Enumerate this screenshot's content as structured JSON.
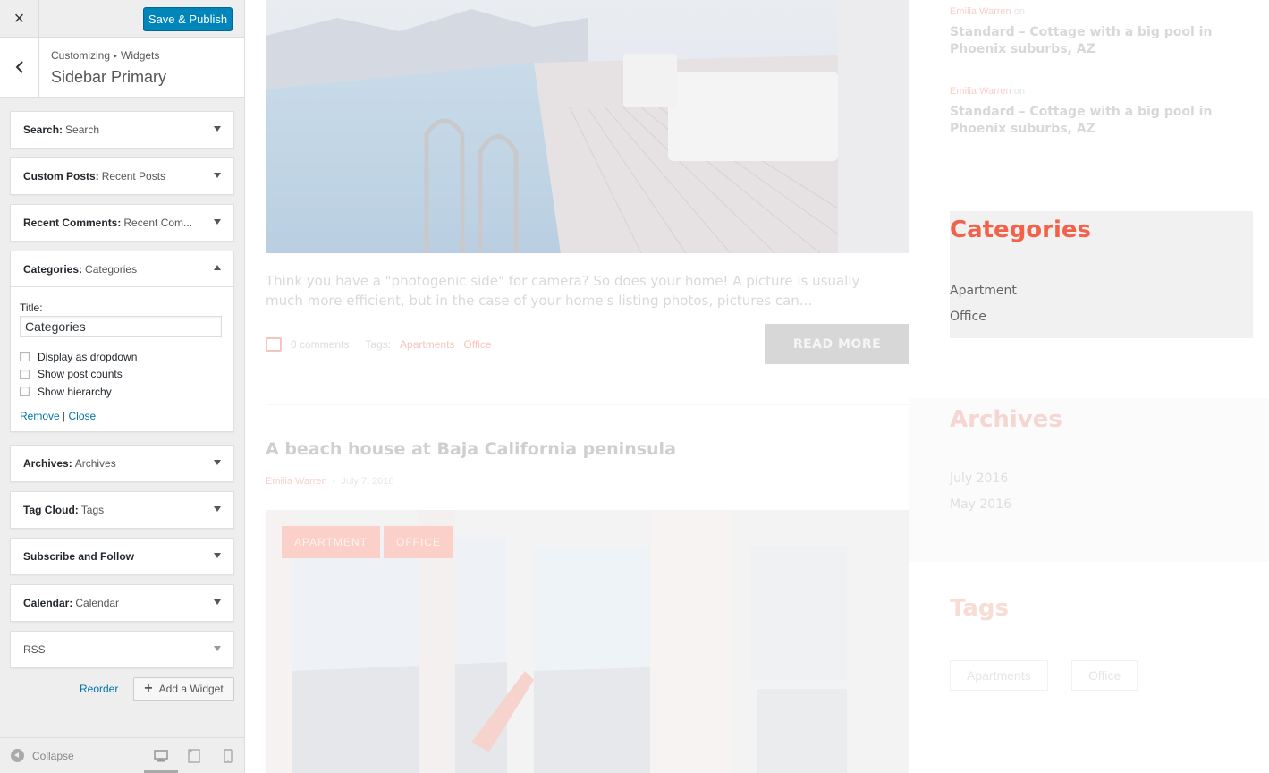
{
  "header": {
    "close_label": "×",
    "publish_label": "Save & Publish"
  },
  "section": {
    "breadcrumb_root": "Customizing",
    "breadcrumb_sep": "▸",
    "breadcrumb_current": "Widgets",
    "title": "Sidebar Primary"
  },
  "widgets": [
    {
      "name": "Search:",
      "sub": "Search"
    },
    {
      "name": "Custom Posts:",
      "sub": "Recent Posts"
    },
    {
      "name": "Recent Comments:",
      "sub": "Recent Com..."
    },
    {
      "name": "Categories:",
      "sub": "Categories"
    },
    {
      "name": "Archives:",
      "sub": "Archives"
    },
    {
      "name": "Tag Cloud:",
      "sub": "Tags"
    },
    {
      "name": "Subscribe and Follow",
      "sub": ""
    },
    {
      "name": "Calendar:",
      "sub": "Calendar"
    },
    {
      "name": "RSS",
      "sub": ""
    }
  ],
  "categories_form": {
    "title_label": "Title:",
    "title_value": "Categories",
    "options": [
      "Display as dropdown",
      "Show post counts",
      "Show hierarchy"
    ],
    "remove_label": "Remove",
    "sep": "|",
    "close_label": "Close"
  },
  "footer_actions": {
    "reorder": "Reorder",
    "add_widget": "Add a Widget"
  },
  "footer": {
    "collapse": "Collapse"
  },
  "preview": {
    "excerpt": "Think you have a \"photogenic side\" for camera? So does your home! A picture is usually much more efficient, but in the case of your home's listing photos, pictures can...",
    "comments": "0 comments",
    "tags_label": "Tags:",
    "tag_1": "Apartments",
    "tag_2": "Office",
    "read_more": "READ MORE",
    "post_title": "A beach house at Baja California peninsula",
    "post_author": "Emilia Warren",
    "post_dash": "-",
    "post_date": "July 7, 2016",
    "badge_1": "APARTMENT",
    "badge_2": "OFFICE",
    "recent": [
      {
        "author": "Emilia Warren",
        "on": "on",
        "title": "Standard – Cottage with a big pool in Phoenix suburbs, AZ"
      },
      {
        "author": "Emilia Warren",
        "on": "on",
        "title": "Standard – Cottage with a big pool in Phoenix suburbs, AZ"
      }
    ],
    "categories_heading": "Categories",
    "categories": [
      "Apartment",
      "Office"
    ],
    "archives_heading": "Archives",
    "archives": [
      "July 2016",
      "May 2016"
    ],
    "tags_heading": "Tags",
    "tag_cloud": [
      "Apartments",
      "Office"
    ]
  },
  "colors": {
    "accent": "#0085ba",
    "brand_red": "#f2624b",
    "link": "#0073aa"
  }
}
